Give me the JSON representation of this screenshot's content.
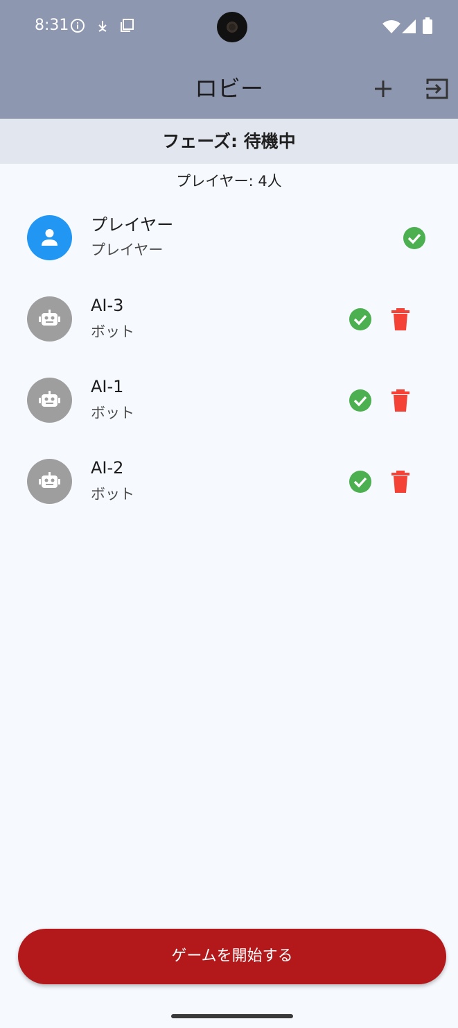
{
  "status_bar": {
    "time": "8:31",
    "icons": [
      "info-icon",
      "download-icon",
      "copy-icon",
      "wifi-icon",
      "signal-icon",
      "battery-icon"
    ]
  },
  "app_bar": {
    "title": "ロビー",
    "actions": [
      "add-icon",
      "exit-icon"
    ]
  },
  "phase": {
    "label": "フェーズ: 待機中"
  },
  "players_count": "プレイヤー: 4人",
  "players": [
    {
      "name": "プレイヤー",
      "role": "プレイヤー",
      "avatar": "person-icon",
      "ready": true,
      "removable": false
    },
    {
      "name": "AI-3",
      "role": "ボット",
      "avatar": "robot-icon",
      "ready": true,
      "removable": true
    },
    {
      "name": "AI-1",
      "role": "ボット",
      "avatar": "robot-icon",
      "ready": true,
      "removable": true
    },
    {
      "name": "AI-2",
      "role": "ボット",
      "avatar": "robot-icon",
      "ready": true,
      "removable": true
    }
  ],
  "start_button": {
    "label": "ゲームを開始する"
  },
  "colors": {
    "app_bar": "#8d97b0",
    "phase_bar": "#e2e6ee",
    "background": "#f6f9fd",
    "player_avatar": "#2196f3",
    "bot_avatar": "#9e9e9e",
    "ready": "#4caf50",
    "delete": "#f44336",
    "start_button": "#b3191b"
  }
}
